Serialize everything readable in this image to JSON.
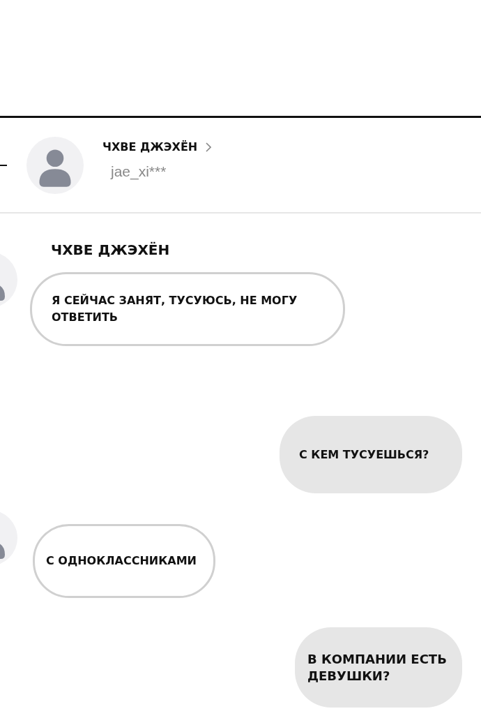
{
  "contact": {
    "name": "ЧХВЕ ДЖЭХЁН",
    "handle": "jae_xi***"
  },
  "messages": [
    {
      "kind": "incoming",
      "sender": "ЧХВЕ ДЖЭХЁН",
      "text": "Я СЕЙЧАС ЗАНЯТ, ТУСУЮСЬ, НЕ МОГУ ОТВЕТИТЬ"
    },
    {
      "kind": "outgoing",
      "text": "С КЕМ ТУСУЕШЬСЯ?"
    },
    {
      "kind": "incoming",
      "text": "С ОДНОКЛАССНИКАМИ"
    },
    {
      "kind": "outgoing",
      "text": "В КОМПАНИИ ЕСТЬ ДЕВУШКИ?"
    }
  ]
}
